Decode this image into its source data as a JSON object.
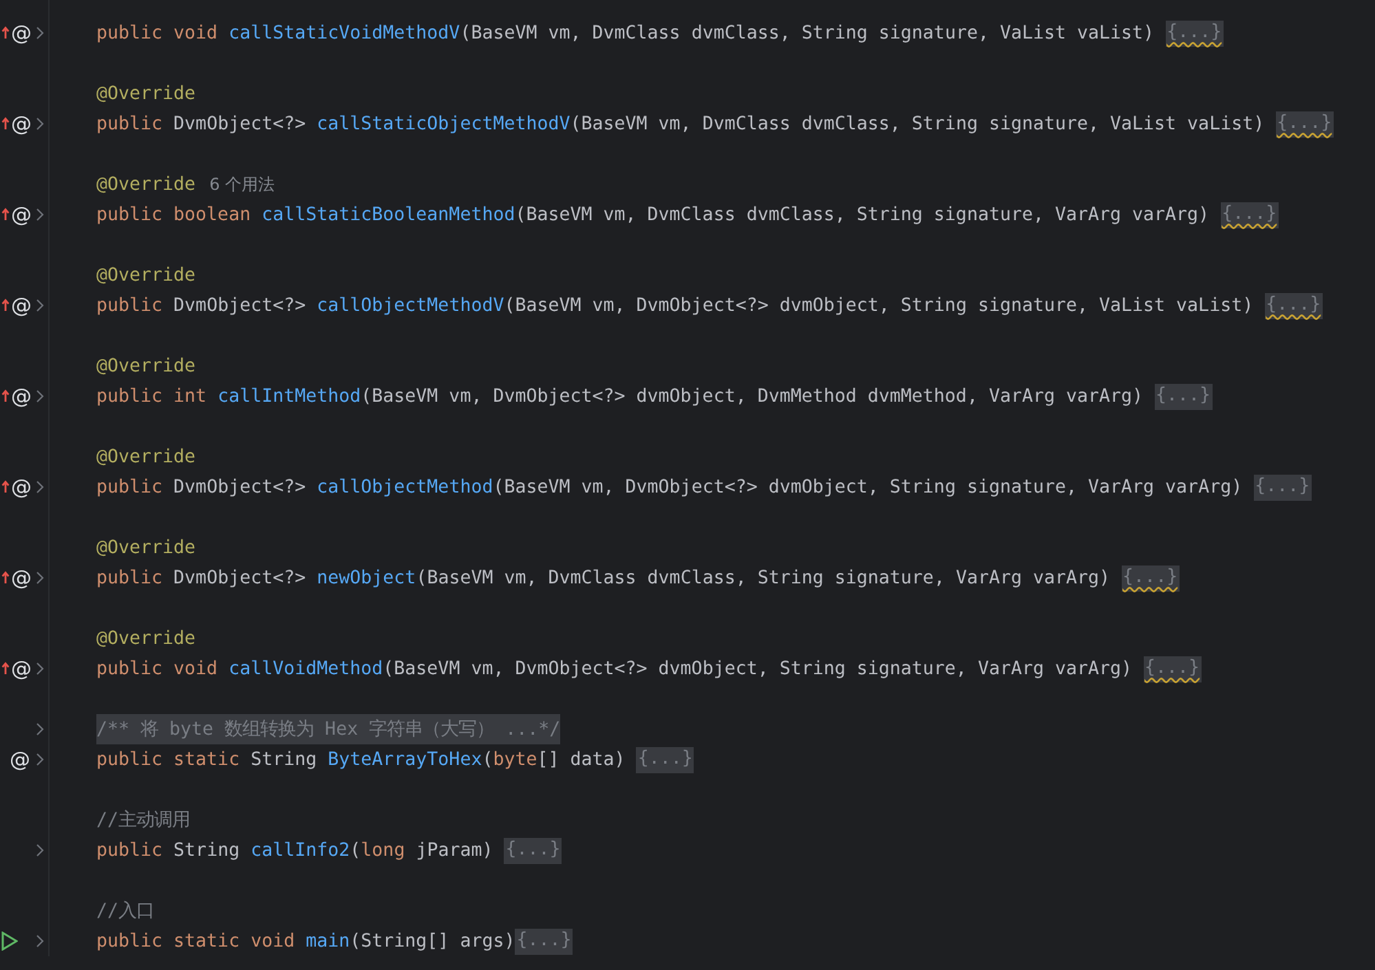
{
  "editor": {
    "lines": [
      {
        "kind": "blank",
        "foldable": false
      },
      {
        "kind": "code",
        "marker": {
          "kind": "override",
          "symbol": "@"
        },
        "foldable": true,
        "tokens": [
          {
            "kind": "kw",
            "text": "public void "
          },
          {
            "kind": "method",
            "text": "callStaticVoidMethodV"
          },
          {
            "kind": "plain",
            "text": "(BaseVM vm, DvmClass dvmClass, String signature, VaList vaList) "
          }
        ],
        "fold": {
          "text": "{...}",
          "warning": true
        }
      },
      {
        "kind": "blank",
        "foldable": false
      },
      {
        "kind": "code",
        "foldable": false,
        "tokens": [
          {
            "kind": "annotation",
            "text": "@Override"
          }
        ]
      },
      {
        "kind": "code",
        "marker": {
          "kind": "override",
          "symbol": "@"
        },
        "foldable": true,
        "tokens": [
          {
            "kind": "kw",
            "text": "public "
          },
          {
            "kind": "plain",
            "text": "DvmObject<?> "
          },
          {
            "kind": "method",
            "text": "callStaticObjectMethodV"
          },
          {
            "kind": "plain",
            "text": "(BaseVM vm, DvmClass dvmClass, String signature, VaList vaList) "
          }
        ],
        "fold": {
          "text": "{...}",
          "warning": true
        }
      },
      {
        "kind": "blank",
        "foldable": false
      },
      {
        "kind": "code",
        "foldable": false,
        "tokens": [
          {
            "kind": "annotation",
            "text": "@Override"
          }
        ],
        "hint": "6 个用法"
      },
      {
        "kind": "code",
        "marker": {
          "kind": "override",
          "symbol": "@"
        },
        "foldable": true,
        "tokens": [
          {
            "kind": "kw",
            "text": "public boolean "
          },
          {
            "kind": "method",
            "text": "callStaticBooleanMethod"
          },
          {
            "kind": "plain",
            "text": "(BaseVM vm, DvmClass dvmClass, String signature, VarArg varArg) "
          }
        ],
        "fold": {
          "text": "{...}",
          "warning": true
        }
      },
      {
        "kind": "blank",
        "foldable": false
      },
      {
        "kind": "code",
        "foldable": false,
        "tokens": [
          {
            "kind": "annotation",
            "text": "@Override"
          }
        ]
      },
      {
        "kind": "code",
        "marker": {
          "kind": "override",
          "symbol": "@"
        },
        "foldable": true,
        "tokens": [
          {
            "kind": "kw",
            "text": "public "
          },
          {
            "kind": "plain",
            "text": "DvmObject<?> "
          },
          {
            "kind": "method",
            "text": "callObjectMethodV"
          },
          {
            "kind": "plain",
            "text": "(BaseVM vm, DvmObject<?> dvmObject, String signature, VaList vaList) "
          }
        ],
        "fold": {
          "text": "{...}",
          "warning": true
        }
      },
      {
        "kind": "blank",
        "foldable": false
      },
      {
        "kind": "code",
        "foldable": false,
        "tokens": [
          {
            "kind": "annotation",
            "text": "@Override"
          }
        ]
      },
      {
        "kind": "code",
        "marker": {
          "kind": "override",
          "symbol": "@"
        },
        "foldable": true,
        "tokens": [
          {
            "kind": "kw",
            "text": "public int "
          },
          {
            "kind": "method",
            "text": "callIntMethod"
          },
          {
            "kind": "plain",
            "text": "(BaseVM vm, DvmObject<?> dvmObject, DvmMethod dvmMethod, VarArg varArg) "
          }
        ],
        "fold": {
          "text": "{...}",
          "warning": false
        }
      },
      {
        "kind": "blank",
        "foldable": false
      },
      {
        "kind": "code",
        "foldable": false,
        "tokens": [
          {
            "kind": "annotation",
            "text": "@Override"
          }
        ]
      },
      {
        "kind": "code",
        "marker": {
          "kind": "override",
          "symbol": "@"
        },
        "foldable": true,
        "tokens": [
          {
            "kind": "kw",
            "text": "public "
          },
          {
            "kind": "plain",
            "text": "DvmObject<?> "
          },
          {
            "kind": "method",
            "text": "callObjectMethod"
          },
          {
            "kind": "plain",
            "text": "(BaseVM vm, DvmObject<?> dvmObject, String signature, VarArg varArg) "
          }
        ],
        "fold": {
          "text": "{...}",
          "warning": false
        }
      },
      {
        "kind": "blank",
        "foldable": false
      },
      {
        "kind": "code",
        "foldable": false,
        "tokens": [
          {
            "kind": "annotation",
            "text": "@Override"
          }
        ]
      },
      {
        "kind": "code",
        "marker": {
          "kind": "override",
          "symbol": "@"
        },
        "foldable": true,
        "tokens": [
          {
            "kind": "kw",
            "text": "public "
          },
          {
            "kind": "plain",
            "text": "DvmObject<?> "
          },
          {
            "kind": "method",
            "text": "newObject"
          },
          {
            "kind": "plain",
            "text": "(BaseVM vm, DvmClass dvmClass, String signature, VarArg varArg) "
          }
        ],
        "fold": {
          "text": "{...}",
          "warning": true
        }
      },
      {
        "kind": "blank",
        "foldable": false
      },
      {
        "kind": "code",
        "foldable": false,
        "tokens": [
          {
            "kind": "annotation",
            "text": "@Override"
          }
        ]
      },
      {
        "kind": "code",
        "marker": {
          "kind": "override",
          "symbol": "@"
        },
        "foldable": true,
        "tokens": [
          {
            "kind": "kw",
            "text": "public void "
          },
          {
            "kind": "method",
            "text": "callVoidMethod"
          },
          {
            "kind": "plain",
            "text": "(BaseVM vm, DvmObject<?> dvmObject, String signature, VarArg varArg) "
          }
        ],
        "fold": {
          "text": "{...}",
          "warning": true
        }
      },
      {
        "kind": "blank",
        "foldable": false
      },
      {
        "kind": "folded-comment",
        "foldable": true,
        "text": "/** 将 byte 数组转换为 Hex 字符串（大写） ...*/"
      },
      {
        "kind": "code",
        "marker": {
          "kind": "implement",
          "symbol": "@"
        },
        "foldable": true,
        "tokens": [
          {
            "kind": "kw",
            "text": "public static "
          },
          {
            "kind": "plain",
            "text": "String "
          },
          {
            "kind": "method",
            "text": "ByteArrayToHex"
          },
          {
            "kind": "plain",
            "text": "("
          },
          {
            "kind": "kw",
            "text": "byte"
          },
          {
            "kind": "plain",
            "text": "[] data) "
          }
        ],
        "fold": {
          "text": "{...}",
          "warning": false
        }
      },
      {
        "kind": "blank",
        "foldable": false
      },
      {
        "kind": "code",
        "foldable": false,
        "tokens": [
          {
            "kind": "comment",
            "text": "//主动调用"
          }
        ]
      },
      {
        "kind": "code",
        "foldable": true,
        "tokens": [
          {
            "kind": "kw",
            "text": "public "
          },
          {
            "kind": "plain",
            "text": "String "
          },
          {
            "kind": "method",
            "text": "callInfo2"
          },
          {
            "kind": "plain",
            "text": "("
          },
          {
            "kind": "kw",
            "text": "long "
          },
          {
            "kind": "plain",
            "text": "jParam) "
          }
        ],
        "fold": {
          "text": "{...}",
          "warning": false
        }
      },
      {
        "kind": "blank",
        "foldable": false
      },
      {
        "kind": "code",
        "foldable": false,
        "tokens": [
          {
            "kind": "comment",
            "text": "//入口"
          }
        ]
      },
      {
        "kind": "code",
        "marker": {
          "kind": "run"
        },
        "foldable": true,
        "tokens": [
          {
            "kind": "kw",
            "text": "public static void "
          },
          {
            "kind": "method",
            "text": "main"
          },
          {
            "kind": "plain",
            "text": "(String[] args)"
          }
        ],
        "fold": {
          "text": "{...}",
          "warning": false
        }
      }
    ]
  }
}
